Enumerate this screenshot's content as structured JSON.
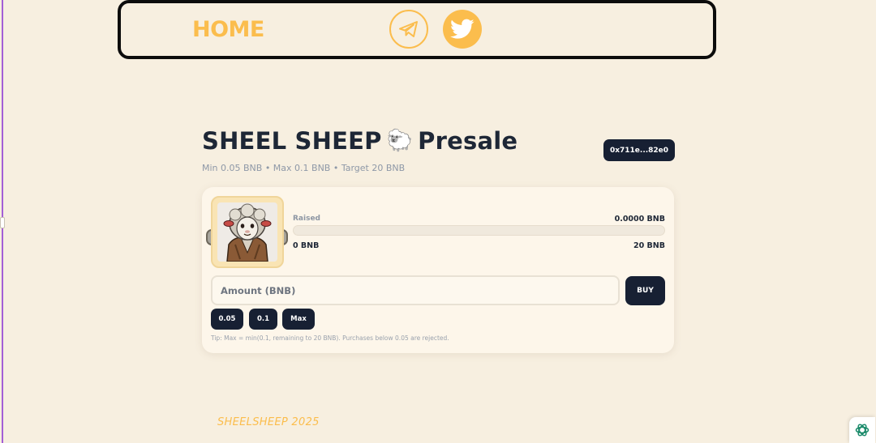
{
  "nav": {
    "home_label": "HOME",
    "telegram_icon": "telegram-icon",
    "twitter_icon": "twitter-icon"
  },
  "presale": {
    "title_left": "SHEEL SHEEP",
    "title_emoji": "🐑",
    "title_right": "Presale",
    "subtitle": "Min 0.05 BNB • Max 0.1 BNB • Target 20 BNB",
    "wallet_address": "0x711e...82e0"
  },
  "card": {
    "raised_label": "Raised",
    "raised_value": "0.0000 BNB",
    "progress_fraction": 0,
    "range_min": "0 BNB",
    "range_max": "20 BNB",
    "amount_placeholder": "Amount (BNB)",
    "buy_label": "BUY",
    "quick_amounts": [
      "0.05",
      "0.1",
      "Max"
    ],
    "tip": "Tip: Max = min(0.1, remaining to 20 BNB). Purchases below 0.05 are rejected."
  },
  "footer": {
    "text": "SHEELSHEEP 2025"
  },
  "colors": {
    "background": "#f7efe0",
    "accent": "#fbbd4d",
    "dark": "#172033",
    "text": "#1e2736",
    "muted": "#8e98a7"
  }
}
